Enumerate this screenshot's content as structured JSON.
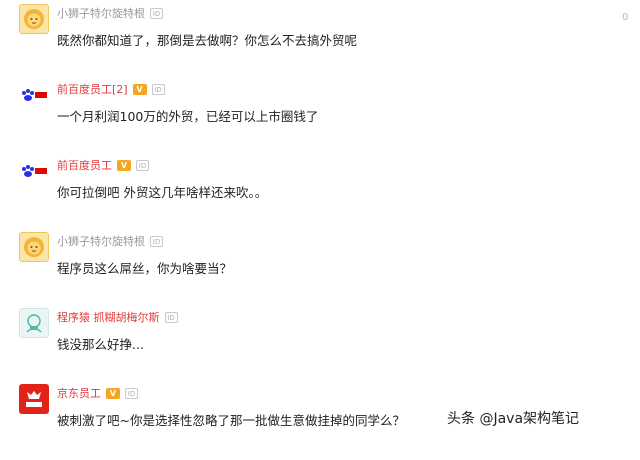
{
  "corner_mark": "0",
  "comments": [
    {
      "user": "小狮子特尔旋特根",
      "badge": "ID",
      "text": "既然你都知道了，那倒是去做啊？你怎么不去搞外贸呢",
      "avatar": "lion-icon"
    },
    {
      "user": "前百度员工[2]",
      "vip": "V",
      "badge": "ID",
      "text": "一个月利润100万的外贸，已经可以上市圈钱了",
      "avatar": "baidu-icon"
    },
    {
      "user": "前百度员工",
      "vip": "V",
      "badge": "ID",
      "text": "你可拉倒吧 外贸这几年啥样还来吹。。",
      "avatar": "baidu-icon"
    },
    {
      "user": "小狮子特尔旋特根",
      "badge": "ID",
      "text": "程序员这么屌丝，你为啥要当？",
      "avatar": "lion-icon"
    },
    {
      "user": "程序猿 抓糊胡梅尔斯",
      "badge": "ID",
      "text": "钱没那么好挣...",
      "avatar": "monkey-icon"
    },
    {
      "user": "京东员工",
      "vip": "V",
      "badge": "ID",
      "text": "被刺激了吧~你是选择性忽略了那一批做生意做挂掉的同学么？",
      "avatar": "jd-icon"
    }
  ],
  "watermark": "头条 @Java架构笔记",
  "colors": {
    "highlight_name": "#e4393c",
    "muted_name": "#999999",
    "vip_badge": "#f6a623",
    "jd_red": "#e2231a"
  }
}
